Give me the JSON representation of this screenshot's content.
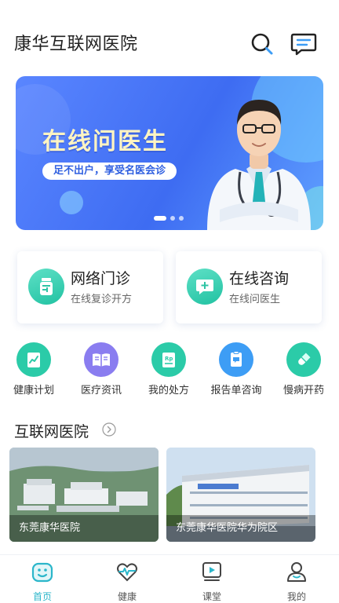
{
  "header": {
    "title": "康华互联网医院",
    "search_icon": "search-icon",
    "message_icon": "message-icon"
  },
  "banner": {
    "headline": "在线问医生",
    "tagline": "足不出户，享受名医会诊",
    "slides": 3,
    "active_slide": 1
  },
  "cards": [
    {
      "title": "网络门诊",
      "subtitle": "在线复诊开方",
      "icon": "medicine-bottle-icon"
    },
    {
      "title": "在线咨询",
      "subtitle": "在线问医生",
      "icon": "chat-plus-icon"
    }
  ],
  "quick_links": [
    {
      "label": "健康计划",
      "icon": "health-plan-icon",
      "color": "#2bcba8"
    },
    {
      "label": "医疗资讯",
      "icon": "book-icon",
      "color": "#8a7df0"
    },
    {
      "label": "我的处方",
      "icon": "prescription-icon",
      "color": "#2bcba8"
    },
    {
      "label": "报告单咨询",
      "icon": "report-chat-icon",
      "color": "#3d9df5"
    },
    {
      "label": "慢病开药",
      "icon": "pill-icon",
      "color": "#2bcba8"
    }
  ],
  "section": {
    "title": "互联网医院",
    "more_icon": "chevron-right-icon"
  },
  "hospitals": [
    {
      "name": "东莞康华医院"
    },
    {
      "name": "东莞康华医院华为院区"
    }
  ],
  "tabbar": {
    "active_color": "#2bb6ca",
    "items": [
      {
        "label": "首页",
        "icon": "home-smile-icon",
        "active": true
      },
      {
        "label": "健康",
        "icon": "heart-pulse-icon",
        "active": false
      },
      {
        "label": "课堂",
        "icon": "video-class-icon",
        "active": false
      },
      {
        "label": "我的",
        "icon": "user-icon",
        "active": false
      }
    ]
  }
}
